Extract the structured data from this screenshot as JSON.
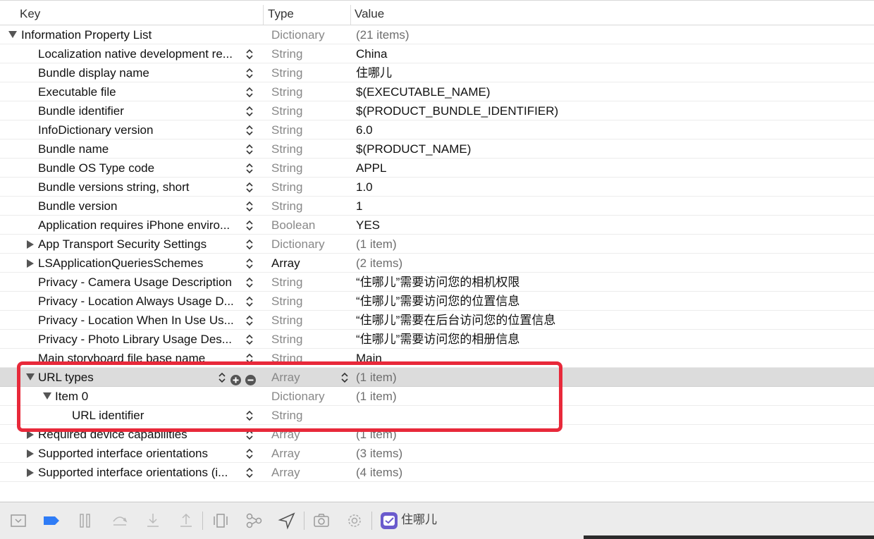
{
  "columns": {
    "key": "Key",
    "type": "Type",
    "value": "Value"
  },
  "rows": [
    {
      "key": "Information Property List",
      "type": "Dictionary",
      "value": "(21 items)"
    },
    {
      "key": "Localization native development re...",
      "type": "String",
      "value": "China"
    },
    {
      "key": "Bundle display name",
      "type": "String",
      "value": "住哪儿"
    },
    {
      "key": "Executable file",
      "type": "String",
      "value": "$(EXECUTABLE_NAME)"
    },
    {
      "key": "Bundle identifier",
      "type": "String",
      "value": "$(PRODUCT_BUNDLE_IDENTIFIER)"
    },
    {
      "key": "InfoDictionary version",
      "type": "String",
      "value": "6.0"
    },
    {
      "key": "Bundle name",
      "type": "String",
      "value": "$(PRODUCT_NAME)"
    },
    {
      "key": "Bundle OS Type code",
      "type": "String",
      "value": "APPL"
    },
    {
      "key": "Bundle versions string, short",
      "type": "String",
      "value": "1.0"
    },
    {
      "key": "Bundle version",
      "type": "String",
      "value": "1"
    },
    {
      "key": "Application requires iPhone enviro...",
      "type": "Boolean",
      "value": "YES"
    },
    {
      "key": "App Transport Security Settings",
      "type": "Dictionary",
      "value": "(1 item)"
    },
    {
      "key": "LSApplicationQueriesSchemes",
      "type": "Array",
      "value": "(2 items)"
    },
    {
      "key": "Privacy - Camera Usage Description",
      "type": "String",
      "value": "“住哪儿”需要访问您的相机权限"
    },
    {
      "key": "Privacy - Location Always Usage D...",
      "type": "String",
      "value": "“住哪儿”需要访问您的位置信息"
    },
    {
      "key": "Privacy - Location When In Use Us...",
      "type": "String",
      "value": "“住哪儿”需要在后台访问您的位置信息"
    },
    {
      "key": "Privacy - Photo Library Usage Des...",
      "type": "String",
      "value": "“住哪儿”需要访问您的相册信息"
    },
    {
      "key": "Main storyboard file base name",
      "type": "String",
      "value": "Main"
    },
    {
      "key": "URL types",
      "type": "Array",
      "value": "(1 item)"
    },
    {
      "key": "Item 0",
      "type": "Dictionary",
      "value": "(1 item)"
    },
    {
      "key": "URL identifier",
      "type": "String",
      "value": ""
    },
    {
      "key": "Required device capabilities",
      "type": "Array",
      "value": "(1 item)"
    },
    {
      "key": "Supported interface orientations",
      "type": "Array",
      "value": "(3 items)"
    },
    {
      "key": "Supported interface orientations (i...",
      "type": "Array",
      "value": "(4 items)"
    }
  ],
  "toolbar": {
    "scheme_label": "住哪儿",
    "icons": [
      "hide-debug-area-icon",
      "breakpoints-icon",
      "pause-icon",
      "step-over-icon",
      "step-into-icon",
      "step-out-icon",
      "view-hierarchy-icon",
      "memory-graph-icon",
      "simulate-location-icon",
      "screenshot-icon",
      "environment-overrides-icon",
      "scheme-app-icon"
    ]
  },
  "colors": {
    "highlight": "#e8293a",
    "selected_row": "#dcdcdc",
    "toolbar_bg": "#ececec",
    "breakpoint_blue": "#2f7cf6"
  }
}
